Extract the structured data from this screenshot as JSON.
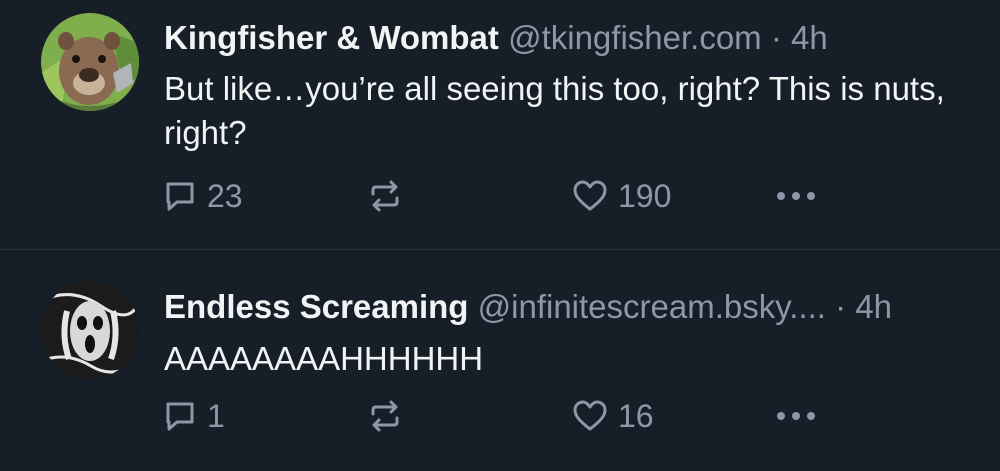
{
  "posts": [
    {
      "author_name": "Kingfisher & Wombat",
      "handle": "@tkingfisher.com",
      "separator": "·",
      "time": "4h",
      "text": "But like…you’re all seeing this too, right? This is nuts, right?",
      "reply_count": "23",
      "repost_count": "",
      "like_count": "190",
      "avatar_icon": "wombat-avatar-icon"
    },
    {
      "author_name": "Endless Screaming",
      "handle": "@infinitescream.bsky....",
      "separator": "·",
      "time": "4h",
      "text": "AAAAAAAAHHHHHH",
      "reply_count": "1",
      "repost_count": "",
      "like_count": "16",
      "avatar_icon": "scream-avatar-icon"
    }
  ],
  "colors": {
    "background": "#161e27",
    "text": "#f1f3f5",
    "muted": "#8b98a8",
    "divider": "#2a3440"
  },
  "icons": [
    "reply-icon",
    "repost-icon",
    "like-icon",
    "more-icon"
  ]
}
